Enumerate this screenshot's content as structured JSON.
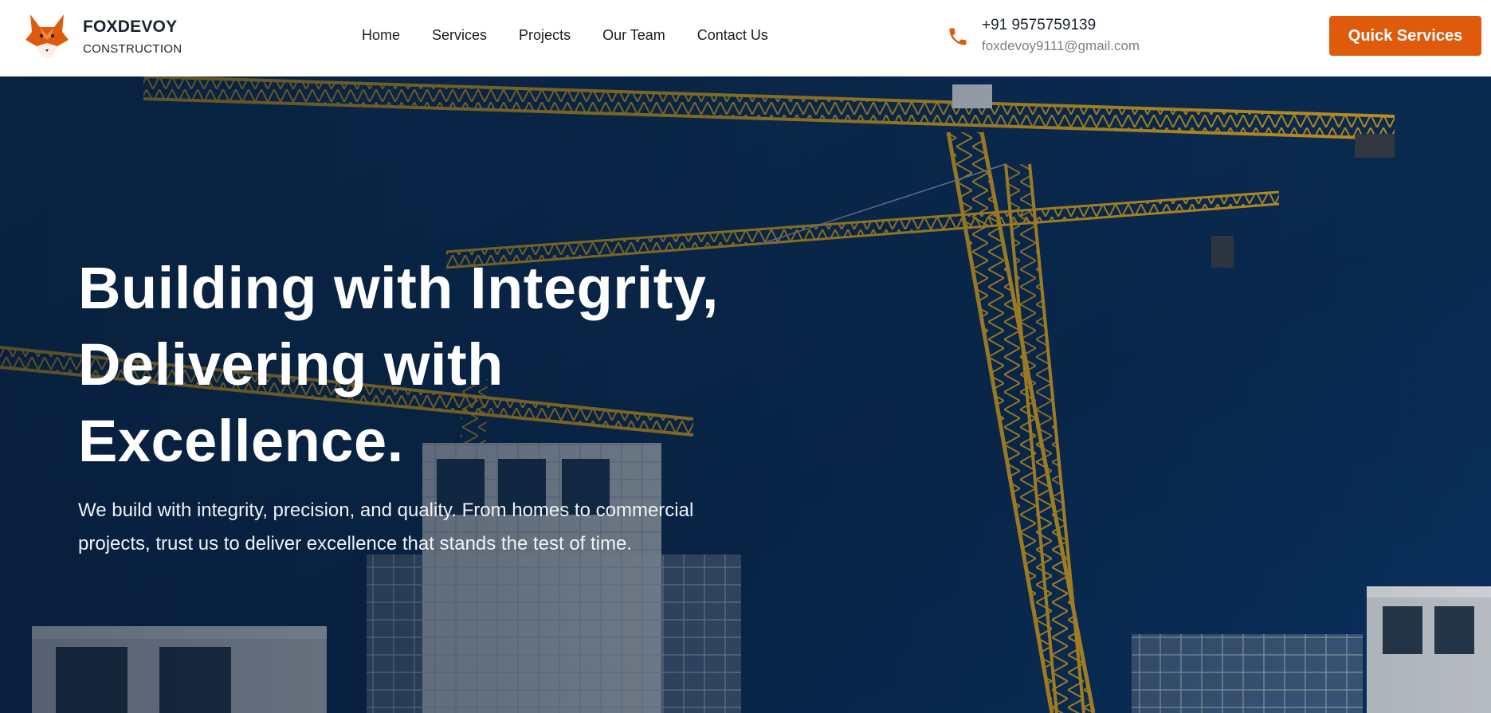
{
  "brand": {
    "name": "FOXDEVOY",
    "subtitle": "CONSTRUCTION",
    "logo_icon": "fox-logo-icon",
    "accent_color": "#e05a0c"
  },
  "nav": {
    "items": [
      {
        "label": "Home"
      },
      {
        "label": "Services"
      },
      {
        "label": "Projects"
      },
      {
        "label": "Our Team"
      },
      {
        "label": "Contact Us"
      }
    ]
  },
  "contact": {
    "phone": "+91 9575759139",
    "email": "foxdevoy9111@gmail.com",
    "icon": "phone-icon"
  },
  "cta": {
    "label": "Quick Services"
  },
  "hero": {
    "title": "Building with Integrity, Delivering with Excellence.",
    "subtitle": "We build with integrity, precision, and quality. From homes to commercial projects, trust us to deliver excellence that stands the test of time.",
    "background_image": "construction-cranes-photo"
  }
}
